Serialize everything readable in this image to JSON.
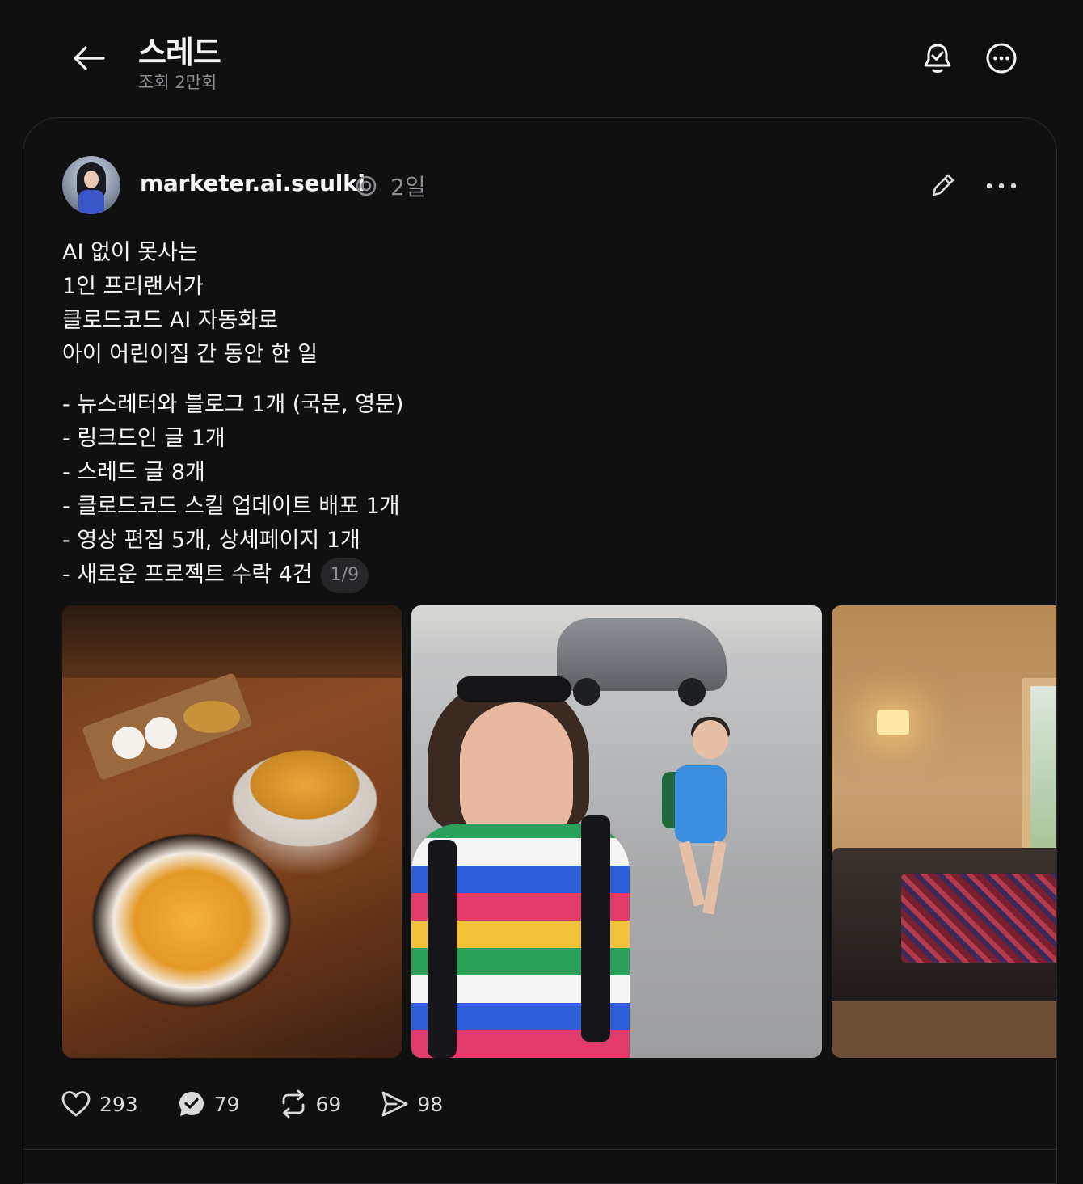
{
  "header": {
    "title": "스레드",
    "subtitle": "조회 2만회"
  },
  "post": {
    "username": "marketer.ai.seulki",
    "time": "2일",
    "lines": [
      "AI 없이 못사는",
      "1인 프리랜서가",
      "클로드코드 AI 자동화로",
      "아이 어린이집 간 동안 한 일"
    ],
    "list": [
      "- 뉴스레터와 블로그 1개 (국문, 영문)",
      "- 링크드인 글 1개",
      "- 스레드 글 8개",
      "- 클로드코드 스킬 업데이트 배포 1개",
      "- 영상 편집 5개, 상세페이지 1개",
      "- 새로운 프로젝트 수락 4건"
    ],
    "page_indicator": "1/9"
  },
  "stats": {
    "likes": "293",
    "replies": "79",
    "reposts": "69",
    "shares": "98"
  },
  "colors": {
    "background": "#0f0f10",
    "text": "#f3f5f7",
    "muted": "#8a8d91",
    "border": "#2a2a2c"
  }
}
